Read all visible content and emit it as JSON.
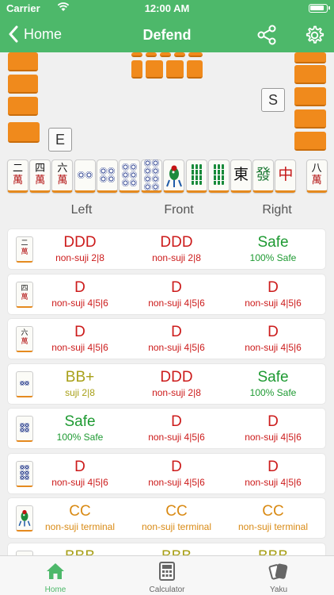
{
  "colors": {
    "accent": "#4db86a",
    "danger": "#cc1b1b",
    "safe": "#1e9a32",
    "warn": "#a8a018",
    "caution": "#d98a14",
    "tile_back": "#f08a1c"
  },
  "status": {
    "carrier": "Carrier",
    "time": "12:00 AM"
  },
  "nav": {
    "back_label": "Home",
    "title": "Defend",
    "share_icon": "share-icon",
    "settings_icon": "gear-icon"
  },
  "table": {
    "east_wind": "E",
    "south_wind": "S"
  },
  "hand": [
    {
      "kind": "man",
      "top": "二",
      "bot": "萬"
    },
    {
      "kind": "man",
      "top": "四",
      "bot": "萬"
    },
    {
      "kind": "man",
      "top": "六",
      "bot": "萬"
    },
    {
      "kind": "pin",
      "count": 2
    },
    {
      "kind": "pin",
      "count": 4
    },
    {
      "kind": "pin",
      "count": 6
    },
    {
      "kind": "pin",
      "count": 8
    },
    {
      "kind": "sou",
      "label": "1-sou"
    },
    {
      "kind": "sou",
      "sticks": 4
    },
    {
      "kind": "sou",
      "sticks": 6
    },
    {
      "kind": "honor",
      "char": "東",
      "color": "#111"
    },
    {
      "kind": "honor",
      "char": "發",
      "color": "#1e7a36"
    },
    {
      "kind": "honor",
      "char": "中",
      "color": "#c41414"
    },
    {
      "kind": "man",
      "top": "八",
      "bot": "萬"
    }
  ],
  "columns": {
    "left": "Left",
    "front": "Front",
    "right": "Right"
  },
  "rows": [
    {
      "tile": {
        "kind": "man",
        "top": "二",
        "bot": "萬"
      },
      "left": {
        "rating": "DDD",
        "detail": "non-suji 2|8",
        "tone": "danger"
      },
      "front": {
        "rating": "DDD",
        "detail": "non-suji 2|8",
        "tone": "danger"
      },
      "right": {
        "rating": "Safe",
        "detail": "100% Safe",
        "tone": "safe"
      }
    },
    {
      "tile": {
        "kind": "man",
        "top": "四",
        "bot": "萬"
      },
      "left": {
        "rating": "D",
        "detail": "non-suji 4|5|6",
        "tone": "danger"
      },
      "front": {
        "rating": "D",
        "detail": "non-suji 4|5|6",
        "tone": "danger"
      },
      "right": {
        "rating": "D",
        "detail": "non-suji 4|5|6",
        "tone": "danger"
      }
    },
    {
      "tile": {
        "kind": "man",
        "top": "六",
        "bot": "萬"
      },
      "left": {
        "rating": "D",
        "detail": "non-suji 4|5|6",
        "tone": "danger"
      },
      "front": {
        "rating": "D",
        "detail": "non-suji 4|5|6",
        "tone": "danger"
      },
      "right": {
        "rating": "D",
        "detail": "non-suji 4|5|6",
        "tone": "danger"
      }
    },
    {
      "tile": {
        "kind": "pin",
        "count": 2
      },
      "left": {
        "rating": "BB+",
        "detail": "suji 2|8",
        "tone": "warn"
      },
      "front": {
        "rating": "DDD",
        "detail": "non-suji 2|8",
        "tone": "danger"
      },
      "right": {
        "rating": "Safe",
        "detail": "100% Safe",
        "tone": "safe"
      }
    },
    {
      "tile": {
        "kind": "pin",
        "count": 4
      },
      "left": {
        "rating": "Safe",
        "detail": "100% Safe",
        "tone": "safe"
      },
      "front": {
        "rating": "D",
        "detail": "non-suji 4|5|6",
        "tone": "danger"
      },
      "right": {
        "rating": "D",
        "detail": "non-suji 4|5|6",
        "tone": "danger"
      }
    },
    {
      "tile": {
        "kind": "pin",
        "count": 6
      },
      "left": {
        "rating": "D",
        "detail": "non-suji 4|5|6",
        "tone": "danger"
      },
      "front": {
        "rating": "D",
        "detail": "non-suji 4|5|6",
        "tone": "danger"
      },
      "right": {
        "rating": "D",
        "detail": "non-suji 4|5|6",
        "tone": "danger"
      }
    },
    {
      "tile": {
        "kind": "sou",
        "label": "1-sou"
      },
      "left": {
        "rating": "CC",
        "detail": "non-suji terminal",
        "tone": "caution"
      },
      "front": {
        "rating": "CC",
        "detail": "non-suji terminal",
        "tone": "caution"
      },
      "right": {
        "rating": "CC",
        "detail": "non-suji terminal",
        "tone": "caution"
      }
    },
    {
      "tile": {
        "kind": "sou",
        "sticks": 4
      },
      "left": {
        "rating": "BBB",
        "detail": "",
        "tone": "warn"
      },
      "front": {
        "rating": "BBB",
        "detail": "",
        "tone": "warn"
      },
      "right": {
        "rating": "BBB",
        "detail": "",
        "tone": "warn"
      }
    }
  ],
  "tabs": [
    {
      "label": "Home",
      "icon": "home-icon",
      "active": true
    },
    {
      "label": "Calculator",
      "icon": "calculator-icon",
      "active": false
    },
    {
      "label": "Yaku",
      "icon": "cards-icon",
      "active": false
    }
  ]
}
